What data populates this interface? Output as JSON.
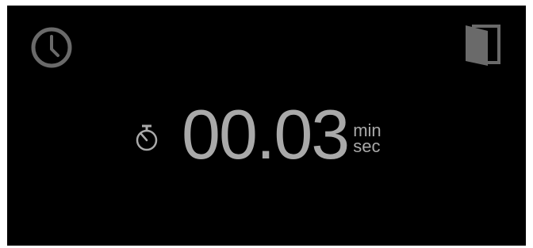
{
  "icons": {
    "history": "clock-icon",
    "door": "door-icon",
    "timer": "stopwatch-icon"
  },
  "timer": {
    "value": "00.03",
    "unit_top": "min",
    "unit_bottom": "sec"
  },
  "colors": {
    "background": "#000000",
    "text": "#a9a9a9",
    "icon": "#6a6a6a"
  }
}
